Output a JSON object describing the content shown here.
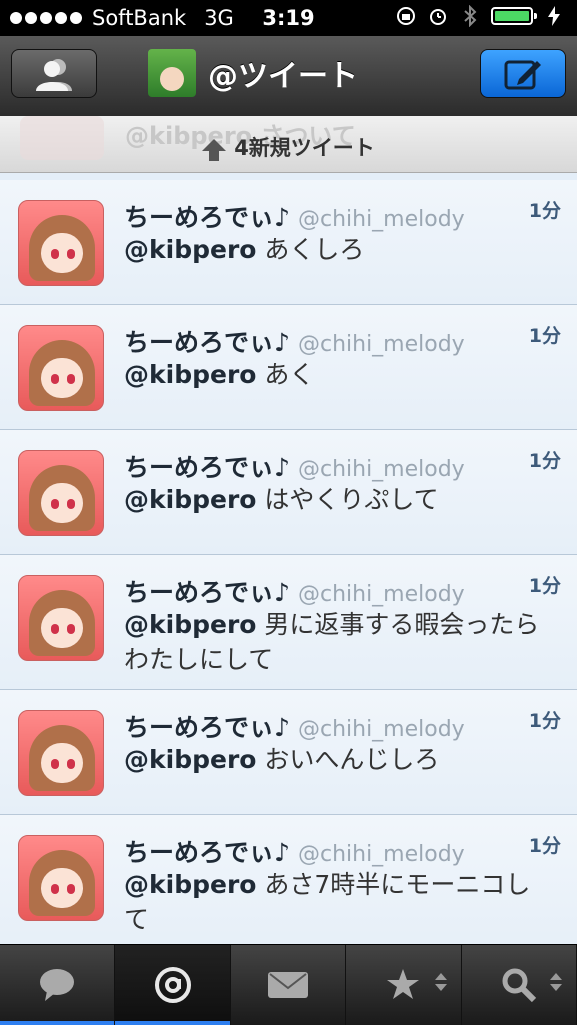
{
  "status_bar": {
    "carrier": "SoftBank",
    "network": "3G",
    "time": "3:19"
  },
  "nav": {
    "title": "@ツイート"
  },
  "banner": {
    "ghost_text": "@kibpero さついて",
    "label": "4新規ツイート"
  },
  "tweets": [
    {
      "name": "ちーめろでぃ♪",
      "handle": "@chihi_melody",
      "time": "1分",
      "mention": "@kibpero",
      "text": "あくしろ"
    },
    {
      "name": "ちーめろでぃ♪",
      "handle": "@chihi_melody",
      "time": "1分",
      "mention": "@kibpero",
      "text": "あく"
    },
    {
      "name": "ちーめろでぃ♪",
      "handle": "@chihi_melody",
      "time": "1分",
      "mention": "@kibpero",
      "text": "はやくりぷして"
    },
    {
      "name": "ちーめろでぃ♪",
      "handle": "@chihi_melody",
      "time": "1分",
      "mention": "@kibpero",
      "text": "男に返事する暇会ったらわたしにして"
    },
    {
      "name": "ちーめろでぃ♪",
      "handle": "@chihi_melody",
      "time": "1分",
      "mention": "@kibpero",
      "text": "おいへんじしろ"
    },
    {
      "name": "ちーめろでぃ♪",
      "handle": "@chihi_melody",
      "time": "1分",
      "mention": "@kibpero",
      "text": "あさ7時半にモーニコして"
    }
  ],
  "tabbar": {
    "active": "mentions",
    "tabs": [
      "timeline-icon",
      "at-icon",
      "envelope-icon",
      "star-icon",
      "search-icon"
    ]
  },
  "colors": {
    "accent": "#2e7ff0",
    "compose_button": "#1a7ff0",
    "battery": "#4cd964"
  }
}
